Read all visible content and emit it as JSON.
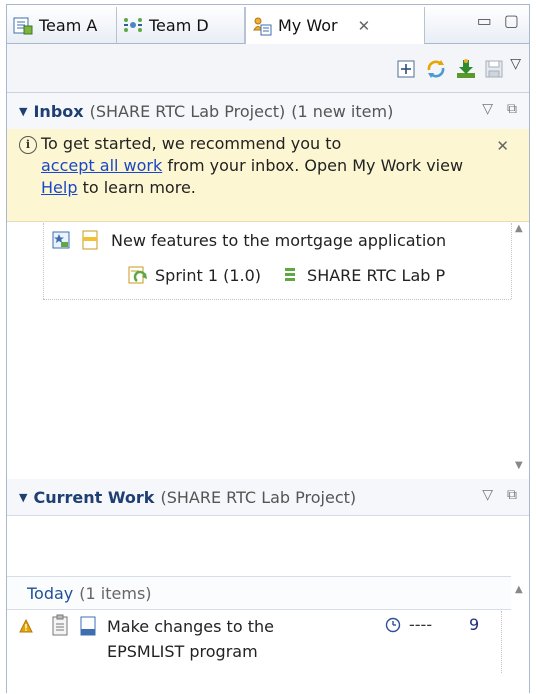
{
  "tabs": [
    {
      "label": "Team A",
      "icon": "team-artifacts-icon"
    },
    {
      "label": "Team D",
      "icon": "team-dashboard-icon"
    },
    {
      "label": "My Wor",
      "icon": "my-work-icon",
      "active": true
    }
  ],
  "tab_close_glyph": "✕",
  "window_controls": {
    "minimize": "▭",
    "maximize": "▢"
  },
  "toolbar": {
    "buttons": [
      "expand-icon",
      "refresh-icon",
      "download-icon",
      "save-icon"
    ],
    "menu_glyph": "▽"
  },
  "inbox": {
    "title": "Inbox",
    "project": "(SHARE RTC Lab Project)",
    "count": "(1 new item)",
    "banner": {
      "line1": "To get started, we recommend you to",
      "link1": "accept all work",
      "mid": " from your inbox. Open My Work view ",
      "link2": "Help",
      "end": " to learn more."
    },
    "items": [
      {
        "label": "New features to the mortgage application"
      },
      {
        "iteration": "Sprint 1 (1.0)",
        "project": "SHARE RTC Lab P"
      }
    ]
  },
  "current_work": {
    "title": "Current Work",
    "project": "(SHARE RTC Lab Project)",
    "group": {
      "title": "Today",
      "count": "(1 items)"
    },
    "item": {
      "line1": "Make changes to the",
      "line2": "EPSMLIST program",
      "estimate": "----",
      "priority": "9"
    }
  },
  "colors": {
    "accent": "#1f3f73",
    "link": "#1a47c7",
    "banner_bg": "#fcf7d2",
    "warning": "#e8a400"
  }
}
